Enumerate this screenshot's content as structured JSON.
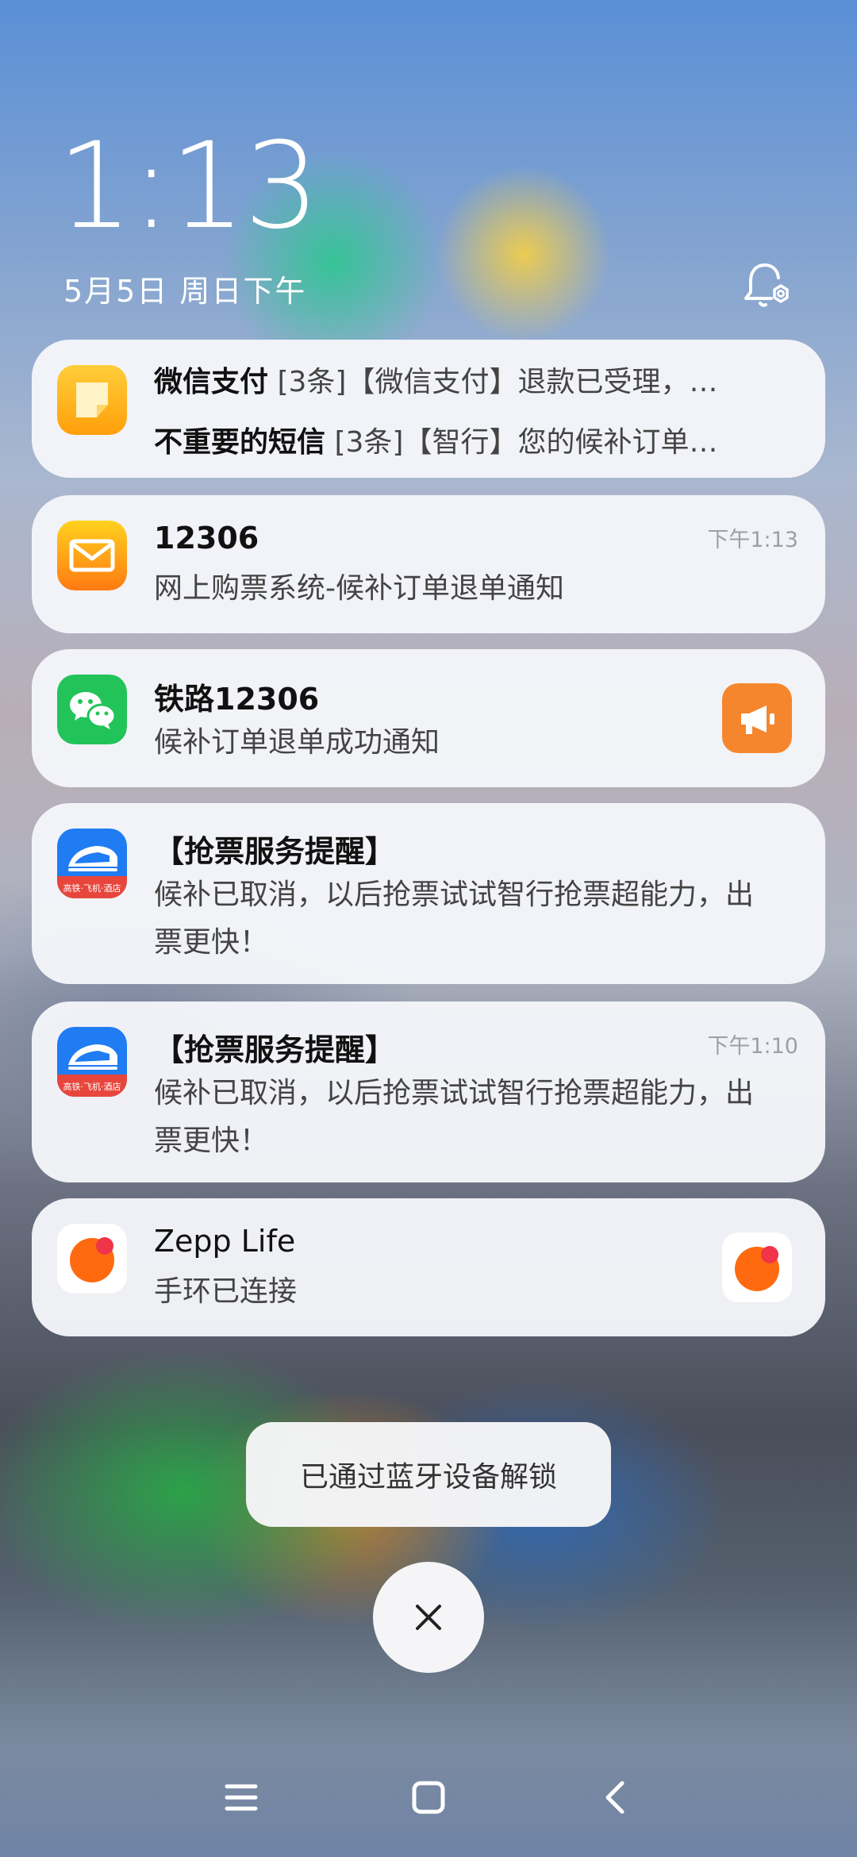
{
  "lockscreen": {
    "time": "1:13",
    "date": "5月5日 周日下午"
  },
  "notifications": {
    "group": {
      "line1_app": "微信支付",
      "line1_text": "[3条]【微信支付】退款已受理，…",
      "line2_app": "不重要的短信",
      "line2_text": "[3条]【智行】您的候补订单…"
    },
    "n12306": {
      "title": "12306",
      "body": "网上购票系统-候补订单退单通知",
      "time": "下午1:13"
    },
    "wechat": {
      "title": "铁路12306",
      "body": "候补订单退单成功通知"
    },
    "zhixing1": {
      "title": "【抢票服务提醒】",
      "body": "候补已取消，以后抢票试试智行抢票超能力，出票更快！"
    },
    "zhixing2": {
      "title": "【抢票服务提醒】",
      "body": "候补已取消，以后抢票试试智行抢票超能力，出票更快！",
      "time": "下午1:10"
    },
    "zepp": {
      "title": "Zepp Life",
      "body": "手环已连接"
    },
    "zhixing_icon_caption": "高铁·飞机·酒店"
  },
  "toast": {
    "text": "已通过蓝牙设备解锁"
  },
  "icons": {
    "settings": "notification-settings-icon",
    "close": "close-icon",
    "menu": "menu-icon",
    "home": "home-icon",
    "back": "back-icon"
  }
}
